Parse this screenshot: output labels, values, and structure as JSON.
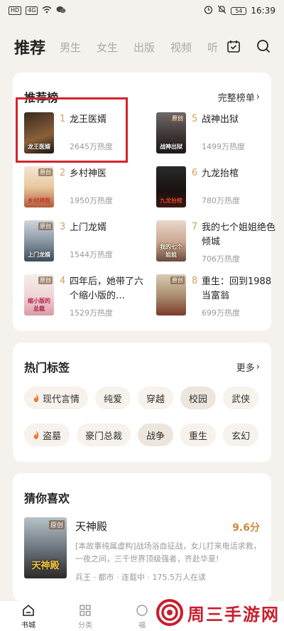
{
  "status_bar": {
    "left_chips": [
      "HD",
      "4G"
    ],
    "time": "16:39",
    "battery": "54"
  },
  "top_tabs": [
    {
      "label": "推荐",
      "active": true
    },
    {
      "label": "男生"
    },
    {
      "label": "女生"
    },
    {
      "label": "出版"
    },
    {
      "label": "视频"
    },
    {
      "label": "听"
    }
  ],
  "ranking": {
    "title": "推荐榜",
    "more_label": "完整榜单",
    "items": [
      {
        "rank": "1",
        "name": "龙王医婿",
        "heat": "2645万热度",
        "cover_text": "龙王医婿"
      },
      {
        "rank": "2",
        "name": "乡村神医",
        "heat": "1950万热度",
        "cover_tag": "原创",
        "cover_text": "乡村神医"
      },
      {
        "rank": "3",
        "name": "上门龙婿",
        "heat": "1544万热度",
        "cover_tag": "原创",
        "cover_text": "上门龙婿"
      },
      {
        "rank": "4",
        "name": "四年后，她带了六个缩小版的…",
        "heat": "1529万热度",
        "cover_tag": "原创",
        "cover_text": "缩小版的总裁"
      },
      {
        "rank": "5",
        "name": "战神出狱",
        "heat": "1499万热度",
        "cover_tag": "原创",
        "cover_text": "战神出狱"
      },
      {
        "rank": "6",
        "name": "九龙抬棺",
        "heat": "780万热度",
        "cover_text": "九龙抬棺"
      },
      {
        "rank": "7",
        "name": "我的七个姐姐绝色倾城",
        "heat": "706万热度",
        "cover_text": "我的七个姐姐"
      },
      {
        "rank": "8",
        "name": "重生：回到1988当富翁",
        "heat": "699万热度",
        "cover_tag": "原创",
        "cover_text": ""
      }
    ]
  },
  "hot_tags": {
    "title": "热门标签",
    "more_label": "更多",
    "row1": [
      {
        "label": "现代言情",
        "hot": true
      },
      {
        "label": "纯爱"
      },
      {
        "label": "穿越"
      },
      {
        "label": "校园",
        "dark": true
      },
      {
        "label": "武侠"
      }
    ],
    "row2": [
      {
        "label": "盗墓",
        "hot": true
      },
      {
        "label": "豪门总裁"
      },
      {
        "label": "战争",
        "dark": true
      },
      {
        "label": "重生"
      },
      {
        "label": "玄幻"
      }
    ]
  },
  "guess": {
    "title": "猜你喜欢",
    "book": {
      "name": "天神殿",
      "score": "9.6分",
      "cover_tag": "原创",
      "cover_text": "天神殿",
      "desc": "[本故事纯属虚构]战场浴血征战，女儿打来电话求救，一夜之间，三千世界顶级强者，齐赴华夏!",
      "meta": "兵王 · 都市 · 连载中 · 175.5万人在读"
    }
  },
  "bottom_nav": [
    {
      "label": "书城",
      "icon": "home-icon",
      "active": true
    },
    {
      "label": "分类",
      "icon": "grid-icon"
    },
    {
      "label": "福",
      "icon": "gift-icon"
    }
  ],
  "watermark": {
    "text": "周三手游网"
  },
  "colors": {
    "accent": "#d8a05a",
    "highlight_border": "#d3242b",
    "watermark_red": "#c81e2b",
    "page_bg": "#f5f1ec"
  }
}
